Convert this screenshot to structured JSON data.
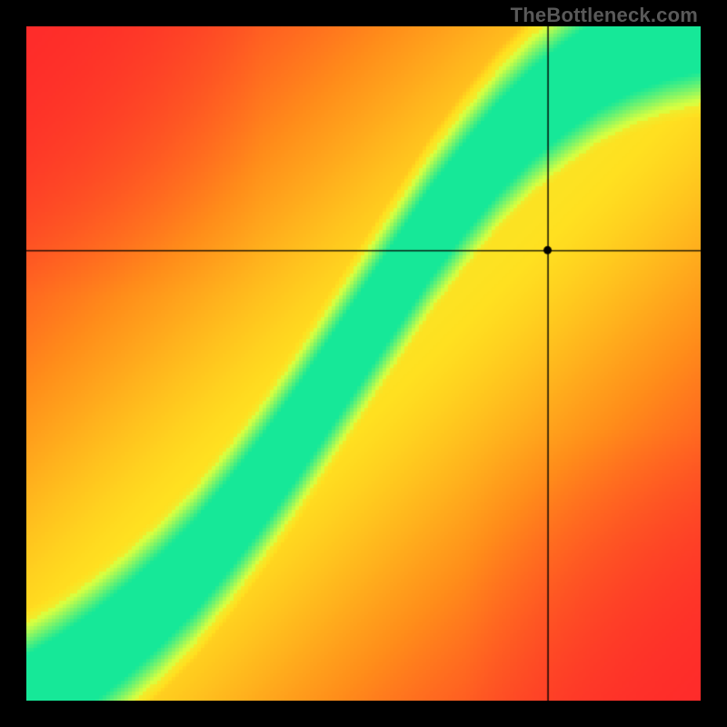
{
  "watermark": "TheBottleneck.com",
  "chart_data": {
    "type": "heatmap",
    "title": "",
    "xlabel": "",
    "ylabel": "",
    "xlim": [
      0,
      1
    ],
    "ylim": [
      0,
      1
    ],
    "crosshair": {
      "x": 0.773,
      "y": 0.668
    },
    "colorscale": {
      "0.0": "#fe2a2a",
      "0.25": "#ff8c1a",
      "0.5": "#ffe020",
      "0.75": "#d8ff40",
      "1.0": "#16e898"
    },
    "optimal_curve": [
      [
        0.0,
        0.0
      ],
      [
        0.05,
        0.03
      ],
      [
        0.1,
        0.065
      ],
      [
        0.15,
        0.105
      ],
      [
        0.2,
        0.15
      ],
      [
        0.25,
        0.2
      ],
      [
        0.3,
        0.26
      ],
      [
        0.35,
        0.325
      ],
      [
        0.4,
        0.395
      ],
      [
        0.45,
        0.47
      ],
      [
        0.5,
        0.545
      ],
      [
        0.55,
        0.62
      ],
      [
        0.6,
        0.695
      ],
      [
        0.65,
        0.76
      ],
      [
        0.7,
        0.82
      ],
      [
        0.75,
        0.87
      ],
      [
        0.8,
        0.91
      ],
      [
        0.85,
        0.945
      ],
      [
        0.9,
        0.97
      ],
      [
        0.95,
        0.988
      ],
      [
        1.0,
        1.0
      ]
    ],
    "band_halfwidth": 0.048,
    "pixelation": 4,
    "grid": false,
    "legend": false
  }
}
